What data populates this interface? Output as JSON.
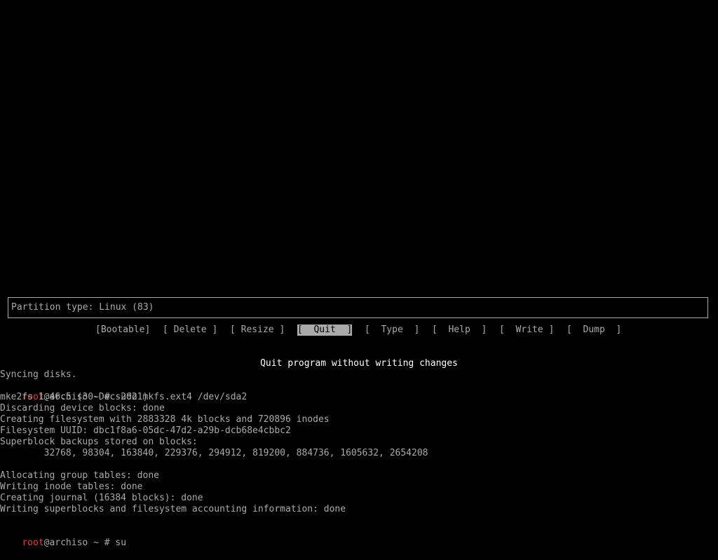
{
  "cfdisk": {
    "info_text": "Partition type: Linux (83)",
    "menu": [
      {
        "label": "[Bootable]",
        "selected": false
      },
      {
        "label": "[ Delete ]",
        "selected": false
      },
      {
        "label": "[ Resize ]",
        "selected": false
      },
      {
        "label": "[  Quit  ]",
        "selected": true
      },
      {
        "label": "[  Type  ]",
        "selected": false
      },
      {
        "label": "[  Help  ]",
        "selected": false
      },
      {
        "label": "[  Write ]",
        "selected": false
      },
      {
        "label": "[  Dump  ]",
        "selected": false
      }
    ],
    "hint": "Quit program without writing changes"
  },
  "terminal": {
    "user": "root",
    "host_prompt": "@archiso ~ # ",
    "lines": [
      "Syncing disks.",
      "",
      "mke2fs 1.46.5 (30-Dec-2021)",
      "Discarding device blocks: done",
      "Creating filesystem with 2883328 4k blocks and 720896 inodes",
      "Filesystem UUID: dbc1f8a6-05dc-47d2-a29b-dcb68e4cbbc2",
      "Superblock backups stored on blocks:",
      "        32768, 98304, 163840, 229376, 294912, 819200, 884736, 1605632, 2654208",
      "",
      "Allocating group tables: done",
      "Writing inode tables: done",
      "Creating journal (16384 blocks): done",
      "Writing superblocks and filesystem accounting information: done",
      "",
      ""
    ],
    "command_1": "sudo mkfs.ext4 /dev/sda2",
    "command_2": "su"
  },
  "colors": {
    "background": "#000000",
    "text": "#aaaaaa",
    "highlight_bg": "#aaaaaa",
    "root_user": "#e04040",
    "hint": "#ffffff"
  }
}
